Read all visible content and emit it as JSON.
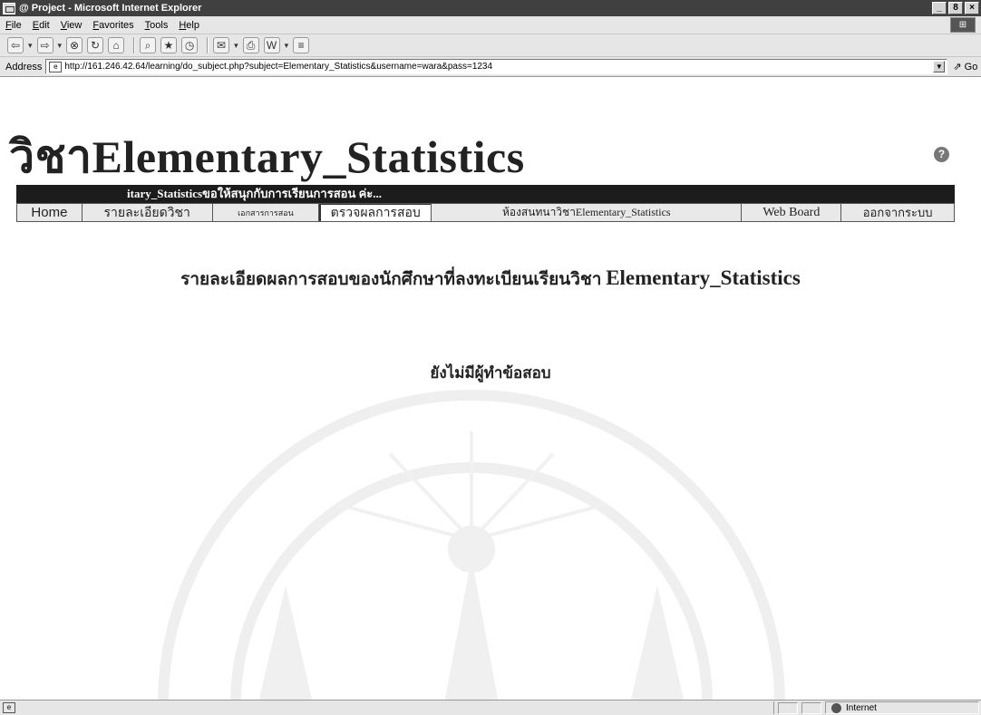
{
  "window": {
    "title": "@ Project - Microsoft Internet Explorer",
    "minimize": "_",
    "restore": "8",
    "close": "×"
  },
  "menu": {
    "items": [
      "File",
      "Edit",
      "View",
      "Favorites",
      "Tools",
      "Help"
    ]
  },
  "addressbar": {
    "label": "Address",
    "url": "http://161.246.42.64/learning/do_subject.php?subject=Elementary_Statistics&username=wara&pass=1234",
    "go_label": "Go"
  },
  "page": {
    "title": "วิชาElementary_Statistics",
    "marquee": "itary_Statisticsขอให้สนุกกับการเรียนการสอน ค่ะ...",
    "nav": {
      "home": "Home",
      "detail": "รายละเอียดวิชา",
      "docs": "เอกสารการสอน",
      "check": "ตรวจผลการสอบ",
      "chat": "ห้องสนทนาวิชาElementary_Statistics",
      "board": "Web Board",
      "logout": "ออกจากระบบ"
    },
    "heading_prefix": "รายละเอียดผลการสอบของนักศึกษาที่ลงทะเบียนเรียนวิชา ",
    "heading_subject": "Elementary_Statistics",
    "empty_message": "ยังไม่มีผู้ทำข้อสอบ"
  },
  "statusbar": {
    "zone": "Internet"
  },
  "icons": {
    "help": "help-icon",
    "globe": "globe-icon"
  }
}
